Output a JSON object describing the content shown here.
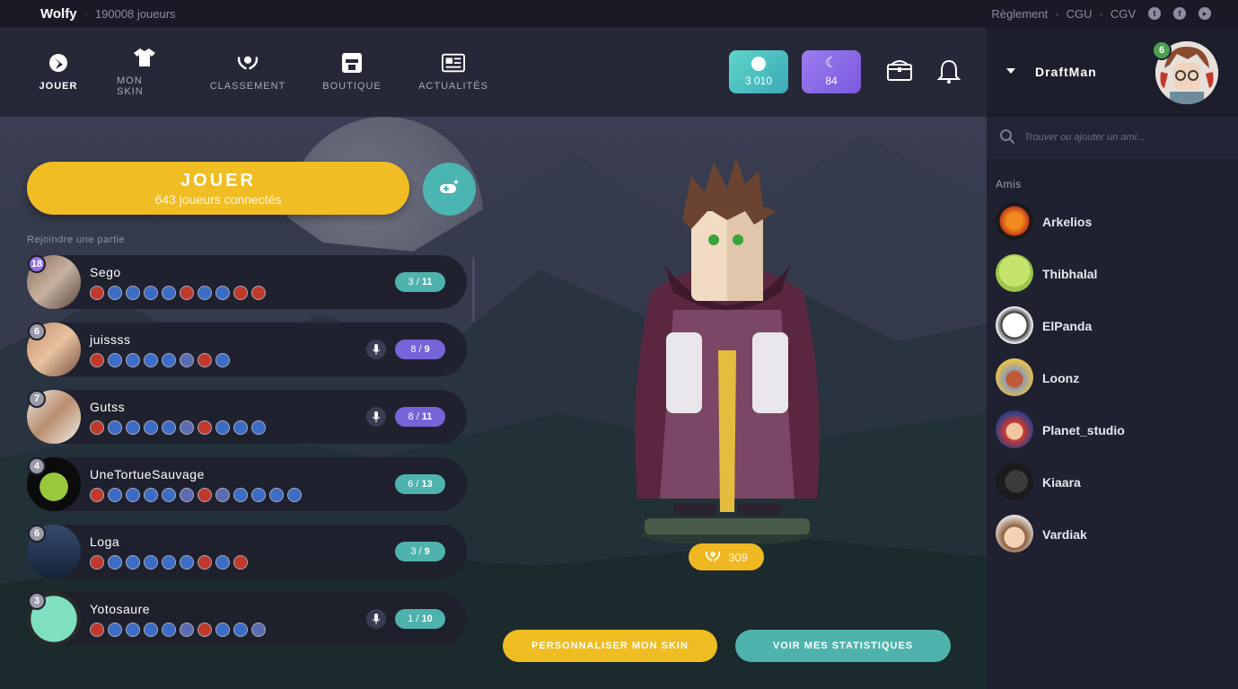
{
  "top": {
    "brand": "Wolfy",
    "separator": "·",
    "players": "190008 joueurs",
    "links": [
      "Règlement",
      "·",
      "CGU",
      "·",
      "CGV"
    ],
    "social": [
      "twitter-icon",
      "facebook-icon",
      "youtube-icon"
    ]
  },
  "nav": [
    {
      "label": "JOUER",
      "icon": "wolf-icon",
      "active": true
    },
    {
      "label": "MON SKIN",
      "icon": "shirt-icon",
      "active": false
    },
    {
      "label": "CLASSEMENT",
      "icon": "laurel-icon",
      "active": false
    },
    {
      "label": "BOUTIQUE",
      "icon": "shop-icon",
      "active": false
    },
    {
      "label": "ACTUALITÉS",
      "icon": "newspaper-icon",
      "active": false
    }
  ],
  "currency": {
    "coins": "3 010",
    "moons": "84"
  },
  "play": {
    "title": "JOUER",
    "subtitle": "643 joueurs connectés",
    "join_label": "Rejoindre une partie"
  },
  "games": [
    {
      "name": "Sego",
      "level": "18",
      "count": "3",
      "max": "11",
      "mic": false
    },
    {
      "name": "juissss",
      "level": "6",
      "count": "8",
      "max": "9",
      "mic": true
    },
    {
      "name": "Gutss",
      "level": "7",
      "count": "8",
      "max": "11",
      "mic": true
    },
    {
      "name": "UneTortueSauvage",
      "level": "4",
      "count": "6",
      "max": "13",
      "mic": false
    },
    {
      "name": "Loga",
      "level": "6",
      "count": "3",
      "max": "9",
      "mic": false
    },
    {
      "name": "Yotosaure",
      "level": "3",
      "count": "1",
      "max": "10",
      "mic": true
    }
  ],
  "character": {
    "score": "309"
  },
  "buttons": {
    "skin": "PERSONNALISER MON SKIN",
    "stats": "VOIR MES STATISTIQUES"
  },
  "profile": {
    "username": "DraftMan",
    "level": "6"
  },
  "search": {
    "placeholder": "Trouver ou ajouter un ami..."
  },
  "friends_label": "Amis",
  "friends": [
    "Arkelios",
    "Thibhalal",
    "ElPanda",
    "Loonz",
    "Planet_studio",
    "Kiaara",
    "Vardiak"
  ],
  "colors": {
    "accent_yellow": "#f0bd24",
    "accent_teal": "#4fb3ad",
    "accent_purple": "#7565d9",
    "background": "#1e1f2c"
  }
}
